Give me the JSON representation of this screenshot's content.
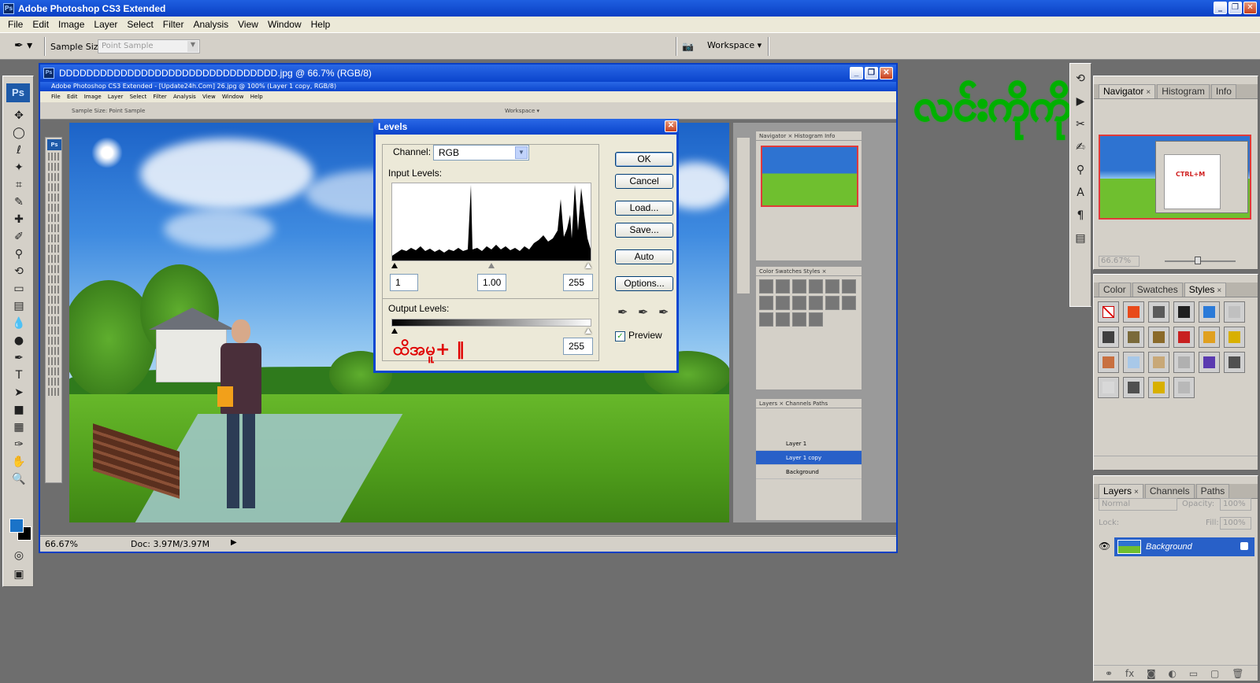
{
  "app": {
    "title": "Adobe Photoshop CS3 Extended",
    "icon_text": "Ps"
  },
  "menu": [
    "File",
    "Edit",
    "Image",
    "Layer",
    "Select",
    "Filter",
    "Analysis",
    "View",
    "Window",
    "Help"
  ],
  "options_bar": {
    "sample_size_label": "Sample Size:",
    "sample_size_value": "Point Sample",
    "workspace_label": "Workspace ▾"
  },
  "document": {
    "title": "DDDDDDDDDDDDDDDDDDDDDDDDDDDDDDDD.jpg @ 66.7% (RGB/8)",
    "zoom": "66.67%",
    "doc_size": "Doc: 3.97M/3.97M",
    "nested_title": "Adobe Photoshop CS3 Extended - [Update24h.Com] 26.jpg @ 100% (Layer 1 copy, RGB/8)",
    "nested_menu": "File Edit Image Layer Select Filter Analysis View Window Help",
    "nested_sample": "Sample Size: Point Sample",
    "nested_workspace": "Workspace ▾",
    "nested_panel_tabs_1": "Navigator × Histogram Info",
    "nested_panel_tabs_2": "Color Swatches Styles ×",
    "nested_panel_tabs_3": "Layers × Channels Paths",
    "nested_layers": [
      "Layer 1",
      "Layer 1 copy",
      "Background"
    ]
  },
  "levels_dialog": {
    "title": "Levels",
    "channel_label": "Channel:",
    "channel_value": "RGB",
    "input_levels_label": "Input Levels:",
    "input_black": "1",
    "input_gamma": "1.00",
    "input_white": "255",
    "output_levels_label": "Output Levels:",
    "output_white": "255",
    "buttons": {
      "ok": "OK",
      "cancel": "Cancel",
      "load": "Load...",
      "save": "Save...",
      "auto": "Auto",
      "options": "Options..."
    },
    "preview_label": "Preview",
    "preview_checked": true,
    "annotation": "ထိအမူ+ ‖"
  },
  "watermark": "လင်းကိုကို",
  "navigator_panel": {
    "tabs": [
      "Navigator",
      "Histogram",
      "Info"
    ],
    "zoom_value": "66.67%",
    "thumb_label": "CTRL+M"
  },
  "color_panel": {
    "tabs": [
      "Color",
      "Swatches",
      "Styles"
    ],
    "style_swatches": [
      "#ffffff",
      "#e84a1a",
      "#5a5a5a",
      "#202020",
      "#2a7ad8",
      "#c0c0c0",
      "#404040",
      "#7a6a3a",
      "#8a6a2a",
      "#c82020",
      "#e0a020",
      "#d8b000",
      "#c87040",
      "#a8c8e8",
      "#c8a878",
      "#b0b0b0",
      "#5a3ab0",
      "#505050",
      "#d8d8d8",
      "#505050",
      "#d8b000",
      "#b8b8b8"
    ]
  },
  "layers_panel": {
    "tabs": [
      "Layers",
      "Channels",
      "Paths"
    ],
    "blend_mode": "Normal",
    "opacity_label": "Opacity:",
    "opacity_value": "100%",
    "lock_label": "Lock:",
    "fill_label": "Fill:",
    "fill_value": "100%",
    "layers": [
      "Background"
    ]
  }
}
